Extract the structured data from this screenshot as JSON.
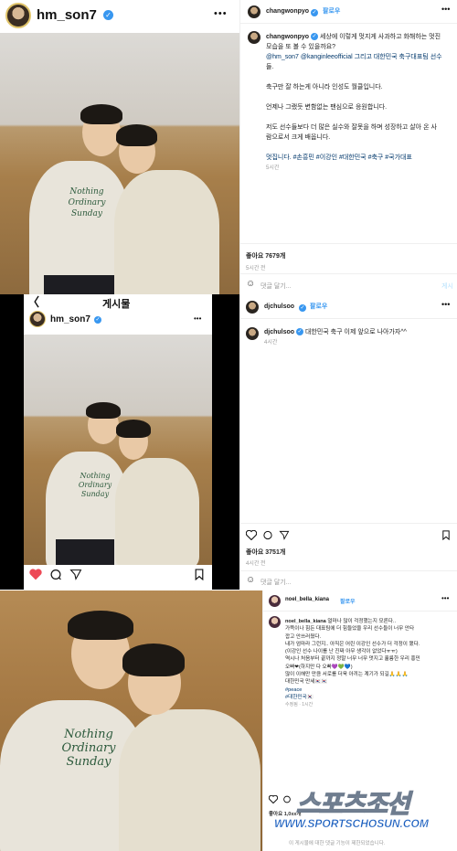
{
  "post1": {
    "username": "hm_son7",
    "more": "•••"
  },
  "right1": {
    "username": "changwonpyo",
    "follow": "팔로우",
    "caption_username": "changwonpyo",
    "caption_lines": [
      "세상에 이렇게 멋지게 사과하고 화해하는 멋진",
      "모습을 또 볼 수 있을까요?",
      "@hm_son7 @kanginleeofficial 그리고 대한민국 축구대표팀 선수",
      "들.",
      "",
      "축구만 잘 하는게 아니라 인성도 월클입니다.",
      "",
      "언제나 그랬듯 변함없는 팬심으로 응원합니다.",
      "",
      "저도 선수들보다 더 많은 실수와 잘못을 하며 성장하고 살아 온 사",
      "람으로서 크게 배웁니다.",
      "",
      "멋집니다. #손흥민 #이강인 #대한민국 #축구 #국가대표"
    ],
    "time": "5시간",
    "likes": "좋아요 7679개",
    "posted": "5시간 전",
    "comment_placeholder": "댓글 달기...",
    "post_btn": "게시"
  },
  "post2": {
    "back": "〈",
    "header_title": "게시물",
    "username": "hm_son7",
    "more": "•••"
  },
  "right2": {
    "username": "djchulsoo",
    "follow": "팔로우",
    "caption_username": "djchulsoo",
    "caption": "대한민국 축구 이제 앞으로 나아가자^^",
    "time": "4시간",
    "likes": "좋아요 3751개",
    "posted": "4시간 전",
    "comment_placeholder": "댓글 달기..."
  },
  "sweater_text": [
    "Nothing",
    "Ordinary",
    "Sunday"
  ],
  "right3": {
    "username": "noel_bella_kiana",
    "follow": "팔로우",
    "caption_username": "noel_bella_kiana",
    "caption_lines": [
      "얼마나 많이 걱정했는지 모른다..",
      "가뜩이나 힘든 대표팀에 더 힘들었을 우리 선수들이 너무 안타",
      "깝고 안쓰러웠다.",
      "내가 엄마라 그런지.. 아직은 어린 이강인 선수가 더 걱정이 됐다.",
      "(이강인 선수 나이를 난 진짜 아무 생각이 없었다ㅠㅠ)",
      "역시나 처음부터 끝까지 정말 너무 너무 멋지고 훌륭한 우리 흥민",
      "오빠❤(하지만 다 오빠💜💚💙)",
      "많이 이해만 만큼 서로를 더욱 아끼는 계기가 되길🙏🙏🙏",
      "대한민국 만세🇰🇷🇰🇷",
      "#peace",
      "#대한민국🇰🇷"
    ],
    "edited": "수정됨 · 1시간",
    "likes": "좋아요 1,0xx개",
    "footer": "이 게시물에 대한 댓글 기능이 제한되었습니다."
  },
  "watermark": {
    "brand": "스포츠조선",
    "url": "WWW.SPORTSCHOSUN.COM"
  },
  "colors": {
    "accent": "#3897f0",
    "like_red": "#ed4956",
    "watermark_blue": "#1b5fbf"
  }
}
